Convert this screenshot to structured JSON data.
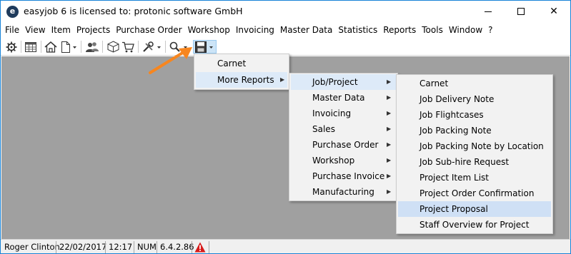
{
  "window": {
    "app_icon_letter": "e",
    "title": "easyjob 6 is licensed to: protonic software GmbH",
    "minimize_icon": "minimize-icon",
    "maximize_icon": "maximize-icon",
    "close_glyph": "✕"
  },
  "menubar": {
    "items": [
      "File",
      "View",
      "Item",
      "Projects",
      "Purchase Order",
      "Workshop",
      "Invoicing",
      "Master Data",
      "Statistics",
      "Reports",
      "Tools",
      "Window",
      "?"
    ]
  },
  "toolbar": {
    "icons": [
      "settings-wheel-icon",
      "table-icon",
      "home-icon",
      "document-icon",
      "users-icon",
      "box-icon",
      "cart-icon",
      "tools-icon",
      "search-icon",
      "save-disk-icon"
    ],
    "highlight_color": "#cce4f7",
    "accent_arrow_color": "#f7861f"
  },
  "menus": {
    "print_menu": {
      "items": [
        {
          "label": "Carnet",
          "has_submenu": false
        },
        {
          "label": "More Reports",
          "has_submenu": true
        }
      ]
    },
    "more_reports": {
      "items": [
        {
          "label": "Job/Project",
          "has_submenu": true
        },
        {
          "label": "Master Data",
          "has_submenu": true
        },
        {
          "label": "Invoicing",
          "has_submenu": true
        },
        {
          "label": "Sales",
          "has_submenu": true
        },
        {
          "label": "Purchase Order",
          "has_submenu": true
        },
        {
          "label": "Workshop",
          "has_submenu": true
        },
        {
          "label": "Purchase Invoice",
          "has_submenu": true
        },
        {
          "label": "Manufacturing",
          "has_submenu": true
        }
      ]
    },
    "job_project": {
      "items": [
        {
          "label": "Carnet"
        },
        {
          "label": "Job Delivery Note"
        },
        {
          "label": "Job Flightcases"
        },
        {
          "label": "Job Packing Note"
        },
        {
          "label": "Job Packing Note by Location"
        },
        {
          "label": "Job Sub-hire Request"
        },
        {
          "label": "Project Item List"
        },
        {
          "label": "Project Order Confirmation"
        },
        {
          "label": "Project Proposal"
        },
        {
          "label": "Staff Overview for Project"
        }
      ]
    }
  },
  "statusbar": {
    "user": "Roger Clinton",
    "date": "22/02/2017",
    "time": "12:17",
    "num": "NUM",
    "version": "6.4.2.86",
    "warning_icon": "warning-icon"
  }
}
